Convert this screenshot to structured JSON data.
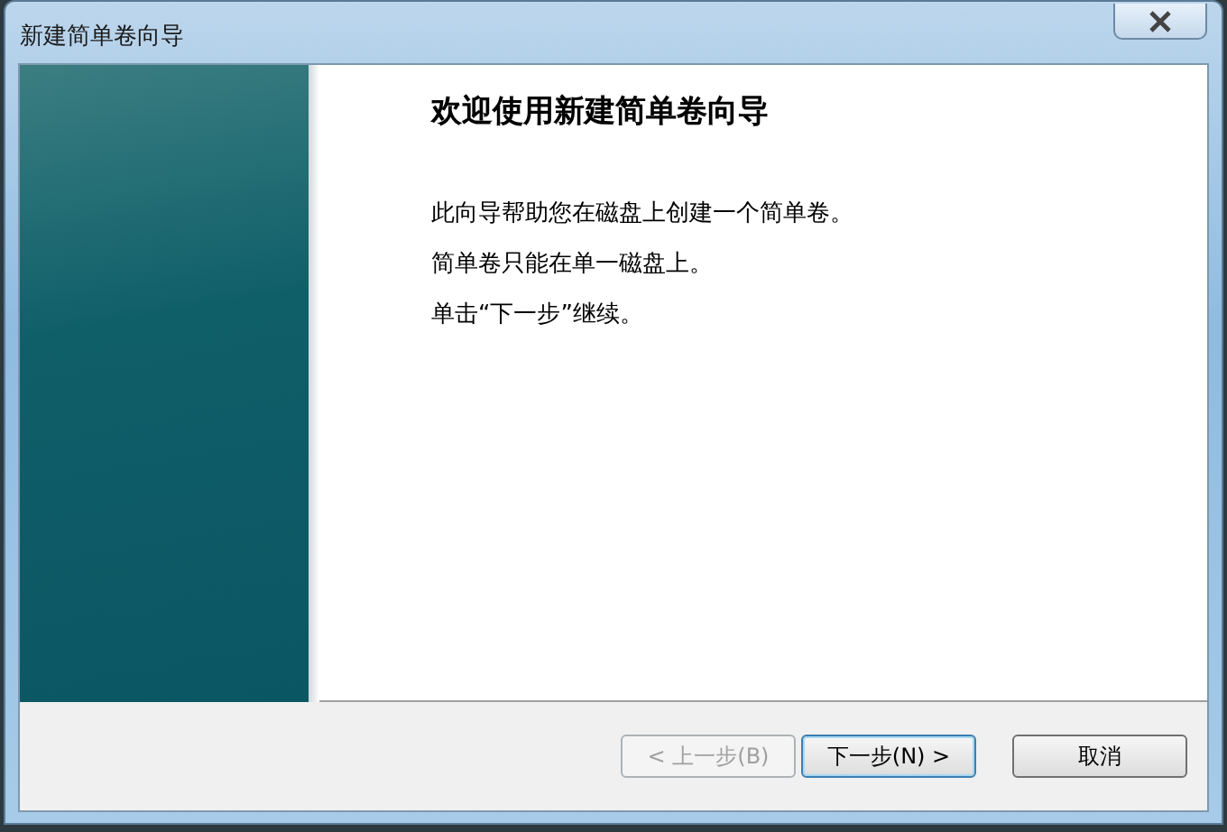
{
  "window": {
    "title": "新建简单卷向导"
  },
  "heading": "欢迎使用新建简单卷向导",
  "paragraphs": [
    "此向导帮助您在磁盘上创建一个简单卷。",
    "简单卷只能在单一磁盘上。",
    "单击“下一步”继续。"
  ],
  "buttons": [
    {
      "label": "< 上一步(B)",
      "disabled": true,
      "default": false
    },
    {
      "label": "下一步(N) >",
      "disabled": false,
      "default": true
    },
    {
      "label": "取消",
      "disabled": false,
      "default": false
    }
  ]
}
